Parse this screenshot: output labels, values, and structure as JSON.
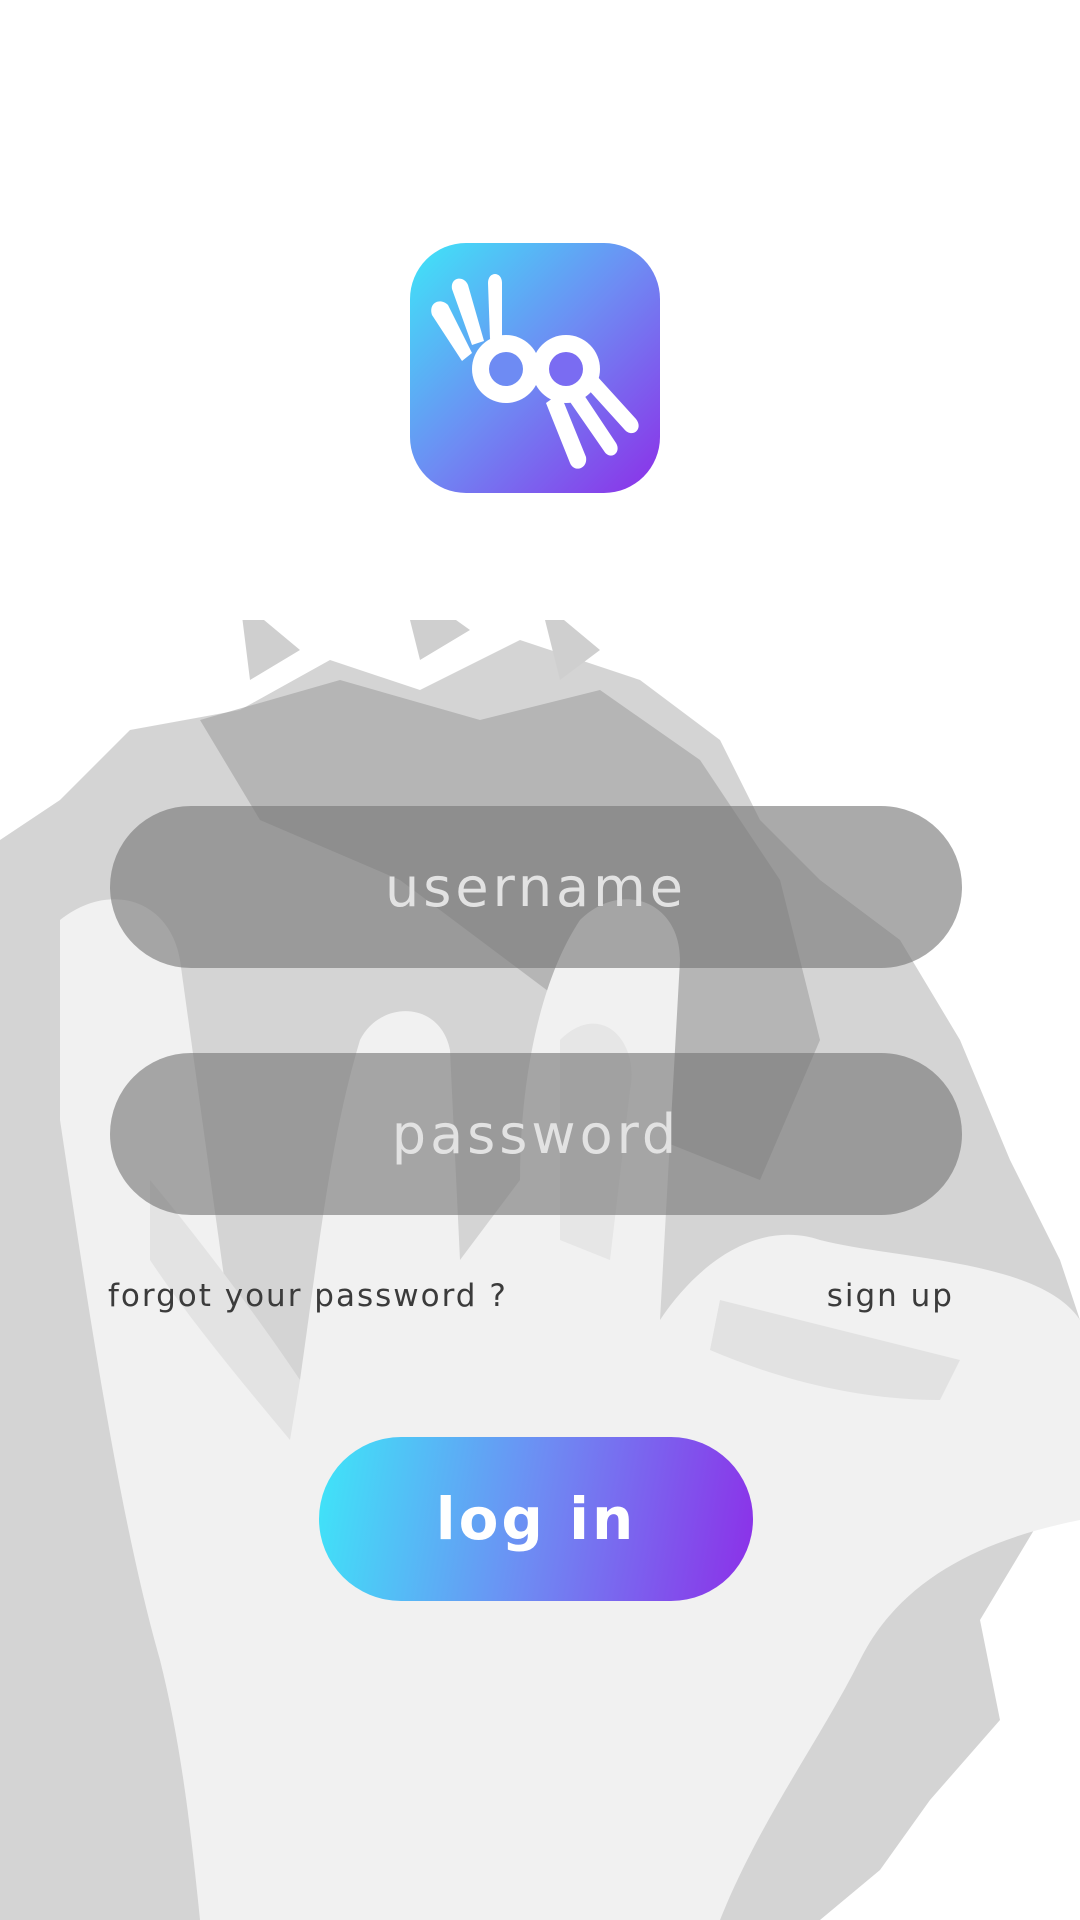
{
  "app": {
    "logo_icon": "ok-hand-sign-icon",
    "brand_gradient": [
      "#3ee6f8",
      "#8c2fe8"
    ]
  },
  "form": {
    "username": {
      "placeholder": "username",
      "value": ""
    },
    "password": {
      "placeholder": "password",
      "value": ""
    },
    "forgot_label": "forgot your password ?",
    "signup_label": "sign up",
    "login_label": "log in"
  },
  "background": {
    "image": "hand-sign-illustration",
    "tone": "#d0d0d0"
  }
}
